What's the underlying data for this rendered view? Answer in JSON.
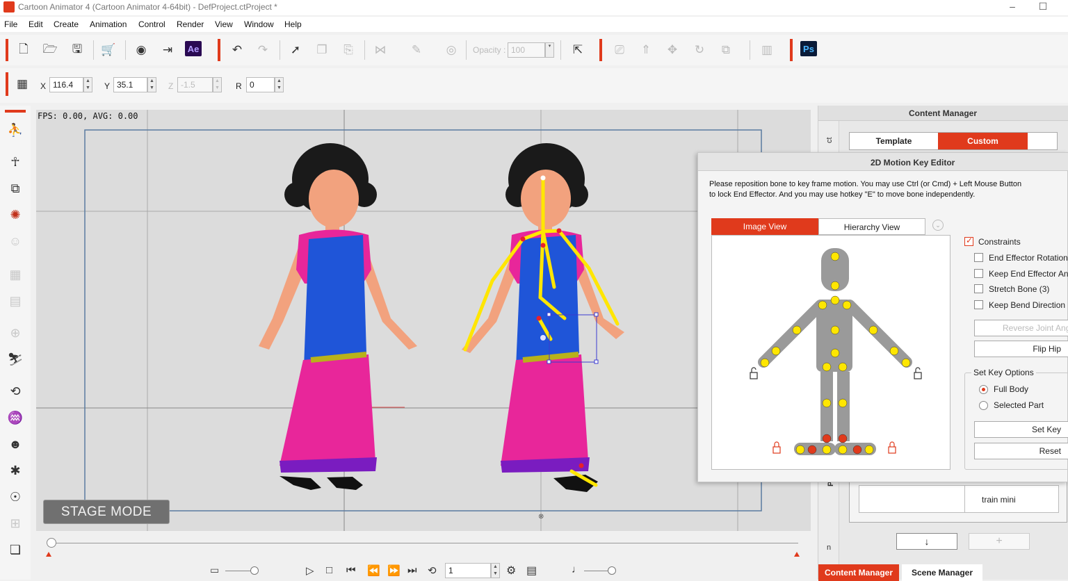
{
  "window": {
    "title": "Cartoon Animator 4  (Cartoon Animator 4-64bit) - DefProject.ctProject *"
  },
  "menu": [
    "File",
    "Edit",
    "Create",
    "Animation",
    "Control",
    "Render",
    "View",
    "Window",
    "Help"
  ],
  "toolbar": {
    "ae_label": "Ae",
    "ps_label": "Ps",
    "opacity_label": "Opacity :",
    "opacity_value": "100"
  },
  "transform": {
    "x_label": "X",
    "x_value": "116.4",
    "y_label": "Y",
    "y_value": "35.1",
    "z_label": "Z",
    "z_value": "-1.5",
    "r_label": "R",
    "r_value": "0"
  },
  "stage": {
    "fps_text": "FPS: 0.00, AVG: 0.00",
    "mode_label": "STAGE MODE"
  },
  "timeline": {
    "frame_value": "1"
  },
  "content_manager": {
    "title": "Content Manager",
    "tab_template": "Template",
    "tab_custom": "Custom",
    "side_label_top": "ct",
    "side_label_prop": "Prop",
    "side_label_n": "n",
    "item_name": "train mini",
    "bottom_tab_content": "Content Manager",
    "bottom_tab_scene": "Scene Manager"
  },
  "motion_editor": {
    "title": "2D Motion Key Editor",
    "instructions_1": "Please reposition bone to key frame motion. You may use Ctrl (or Cmd) + Left Mouse Button",
    "instructions_2": "to lock End Effector. And you may use hotkey \"E\" to move bone independently.",
    "tab_image": "Image View",
    "tab_hierarchy": "Hierarchy View",
    "constraints_label": "Constraints",
    "options": [
      {
        "label": "End Effector Rotation",
        "checked": false
      },
      {
        "label": "Keep End Effector An",
        "checked": false
      },
      {
        "label": "Stretch Bone (3)",
        "checked": false
      },
      {
        "label": "Keep Bend Direction",
        "checked": false
      }
    ],
    "reverse_joint": "Reverse Joint Ang",
    "flip_hip": "Flip Hip",
    "set_key_options_label": "Set Key Options",
    "full_body": "Full Body",
    "selected_part": "Selected Part",
    "set_key": "Set Key",
    "reset": "Reset"
  },
  "colors": {
    "accent": "#e03a1c",
    "stage_bg": "#dcdcdc",
    "bone_yellow": "#ffe600"
  }
}
